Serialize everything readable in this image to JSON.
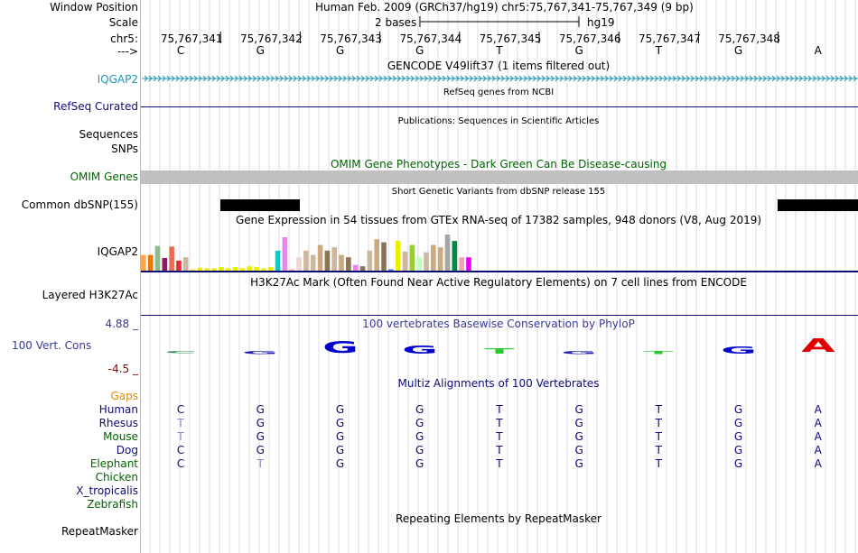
{
  "ruler": {
    "window_label": "Window Position",
    "window_text": "Human Feb. 2009 (GRCh37/hg19)   chr5:75,767,341-75,767,349 (9 bp)",
    "scale_label": "Scale",
    "scale_text": "2 bases",
    "scale_assembly": "hg19",
    "chrom_label": "chr5:",
    "strand_label": "--->",
    "positions": [
      "75,767,341",
      "75,767,342",
      "75,767,343",
      "75,767,344",
      "75,767,345",
      "75,767,346",
      "75,767,347",
      "75,767,348"
    ],
    "bases": [
      "C",
      "G",
      "G",
      "G",
      "T",
      "G",
      "T",
      "G",
      "A"
    ]
  },
  "tracks": {
    "gencode": {
      "title": "GENCODE V49lift37 (1 items filtered out)",
      "label": "IQGAP2",
      "color": "#2196b5"
    },
    "refseq": {
      "title": "RefSeq genes from NCBI",
      "label": "RefSeq Curated",
      "color": "#0c0c78"
    },
    "publications": {
      "title": "Publications: Sequences in Scientific Articles",
      "label1": "Sequences",
      "label2": "SNPs"
    },
    "omim": {
      "title": "OMIM Gene Phenotypes - Dark Green Can Be Disease-causing",
      "label": "OMIM Genes",
      "color": "#006400",
      "bar_color": "#c0c0c0"
    },
    "dbsnp": {
      "title": "Short Genetic Variants from dbSNP release 155",
      "label": "Common dbSNP(155)"
    },
    "gtex": {
      "title": "Gene Expression in 54 tissues from GTEx RNA-seq of 17382 samples, 948 donors (V8, Aug 2019)",
      "label": "IQGAP2",
      "bars": [
        {
          "level": 0.47,
          "color": "#ffa54f"
        },
        {
          "level": 0.47,
          "color": "#ee7600"
        },
        {
          "level": 0.74,
          "color": "#8fbc8f"
        },
        {
          "level": 0.38,
          "color": "#8b1c62"
        },
        {
          "level": 0.72,
          "color": "#ee6a50"
        },
        {
          "level": 0.3,
          "color": "#ee2c2c"
        },
        {
          "level": 0.4,
          "color": "#cdb79e"
        },
        {
          "level": 0.04,
          "color": "#eeee00"
        },
        {
          "level": 0.09,
          "color": "#eeee00"
        },
        {
          "level": 0.07,
          "color": "#eeee00"
        },
        {
          "level": 0.07,
          "color": "#eeee00"
        },
        {
          "level": 0.11,
          "color": "#eeee00"
        },
        {
          "level": 0.07,
          "color": "#eeee00"
        },
        {
          "level": 0.11,
          "color": "#eeee00"
        },
        {
          "level": 0.07,
          "color": "#eeee00"
        },
        {
          "level": 0.13,
          "color": "#eeee00"
        },
        {
          "level": 0.11,
          "color": "#eeee00"
        },
        {
          "level": 0.07,
          "color": "#eeee00"
        },
        {
          "level": 0.11,
          "color": "#eeee00"
        },
        {
          "level": 0.6,
          "color": "#00cdcd"
        },
        {
          "level": 1.0,
          "color": "#ee82ee"
        },
        {
          "level": 0.04,
          "color": "#eeb4b4"
        },
        {
          "level": 0.4,
          "color": "#eed5d2"
        },
        {
          "level": 0.6,
          "color": "#cdb79e"
        },
        {
          "level": 0.47,
          "color": "#cdb79e"
        },
        {
          "level": 0.77,
          "color": "#cdaa7d"
        },
        {
          "level": 0.6,
          "color": "#8b7355"
        },
        {
          "level": 0.7,
          "color": "#cdb79e"
        },
        {
          "level": 0.47,
          "color": "#cdaa7d"
        },
        {
          "level": 0.4,
          "color": "#8b7355"
        },
        {
          "level": 0.17,
          "color": "#ee82ee"
        },
        {
          "level": 0.13,
          "color": "#8b7355"
        },
        {
          "level": 0.6,
          "color": "#cdb79e"
        },
        {
          "level": 0.94,
          "color": "#cdaa7d"
        },
        {
          "level": 0.85,
          "color": "#8b7355"
        },
        {
          "level": 0.04,
          "color": "#4876ff"
        },
        {
          "level": 0.89,
          "color": "#eeee00"
        },
        {
          "level": 0.57,
          "color": "#cdb79e"
        },
        {
          "level": 0.77,
          "color": "#9acd32"
        },
        {
          "level": 0.4,
          "color": "#c1ffc1"
        },
        {
          "level": 0.55,
          "color": "#cdb79e"
        },
        {
          "level": 0.77,
          "color": "#cdaa7d"
        },
        {
          "level": 0.7,
          "color": "#cdaa7d"
        },
        {
          "level": 1.08,
          "color": "#a6a6a6"
        },
        {
          "level": 0.89,
          "color": "#008b45"
        },
        {
          "level": 0.4,
          "color": "#eea2ad"
        },
        {
          "level": 0.4,
          "color": "#ee00ee"
        }
      ]
    },
    "h3k27ac": {
      "title": "H3K27Ac Mark (Often Found Near Active Regulatory Elements) on 7 cell lines from ENCODE",
      "label": "Layered H3K27Ac",
      "color": "#0c0c78"
    },
    "phylop": {
      "title": "100 vertebrates Basewise Conservation by PhyloP",
      "label": "100 Vert. Cons",
      "ymax": "4.88 _",
      "ymin": "-4.5 _",
      "label_color": "#3a3a9a",
      "ymin_color": "#8b0000",
      "logo": [
        {
          "base": "C",
          "score": 0.05,
          "color": "#2e8b57"
        },
        {
          "base": "G",
          "score": 0.1,
          "color": "#1e1eb4"
        },
        {
          "base": "G",
          "score": 0.85,
          "color": "#0000cd"
        },
        {
          "base": "G",
          "score": 0.55,
          "color": "#0000cd"
        },
        {
          "base": "T",
          "score": 0.3,
          "color": "#2bc92b"
        },
        {
          "base": "G",
          "score": 0.1,
          "color": "#1e1eb4"
        },
        {
          "base": "T",
          "score": 0.1,
          "color": "#2bc92b"
        },
        {
          "base": "G",
          "score": 0.45,
          "color": "#0000cd"
        },
        {
          "base": "A",
          "score": 1.0,
          "color": "#e00000"
        }
      ]
    },
    "multiz": {
      "title": "Multiz Alignments of 100 Vertebrates",
      "gaps_label": "Gaps",
      "gaps_color": "#e58a00",
      "species": [
        {
          "name": "Human",
          "color": "#0c0c78",
          "seq": [
            "C",
            "G",
            "G",
            "G",
            "T",
            "G",
            "T",
            "G",
            "A"
          ],
          "faint": []
        },
        {
          "name": "Rhesus",
          "color": "#0c0c78",
          "seq": [
            "T",
            "G",
            "G",
            "G",
            "T",
            "G",
            "T",
            "G",
            "A"
          ],
          "faint": [
            0
          ]
        },
        {
          "name": "Mouse",
          "color": "#006400",
          "seq": [
            "T",
            "G",
            "G",
            "G",
            "T",
            "G",
            "T",
            "G",
            "A"
          ],
          "faint": [
            0
          ]
        },
        {
          "name": "Dog",
          "color": "#0c0c78",
          "seq": [
            "C",
            "G",
            "G",
            "G",
            "T",
            "G",
            "T",
            "G",
            "A"
          ],
          "faint": []
        },
        {
          "name": "Elephant",
          "color": "#006400",
          "seq": [
            "C",
            "T",
            "G",
            "G",
            "T",
            "G",
            "T",
            "G",
            "A"
          ],
          "faint": [
            1
          ]
        },
        {
          "name": "Chicken",
          "color": "#006400",
          "seq": [],
          "faint": []
        },
        {
          "name": "X_tropicalis",
          "color": "#0c0c78",
          "seq": [],
          "faint": []
        },
        {
          "name": "Zebrafish",
          "color": "#006400",
          "seq": [],
          "faint": []
        }
      ]
    },
    "repeatmasker": {
      "title": "Repeating Elements by RepeatMasker",
      "label": "RepeatMasker"
    }
  }
}
